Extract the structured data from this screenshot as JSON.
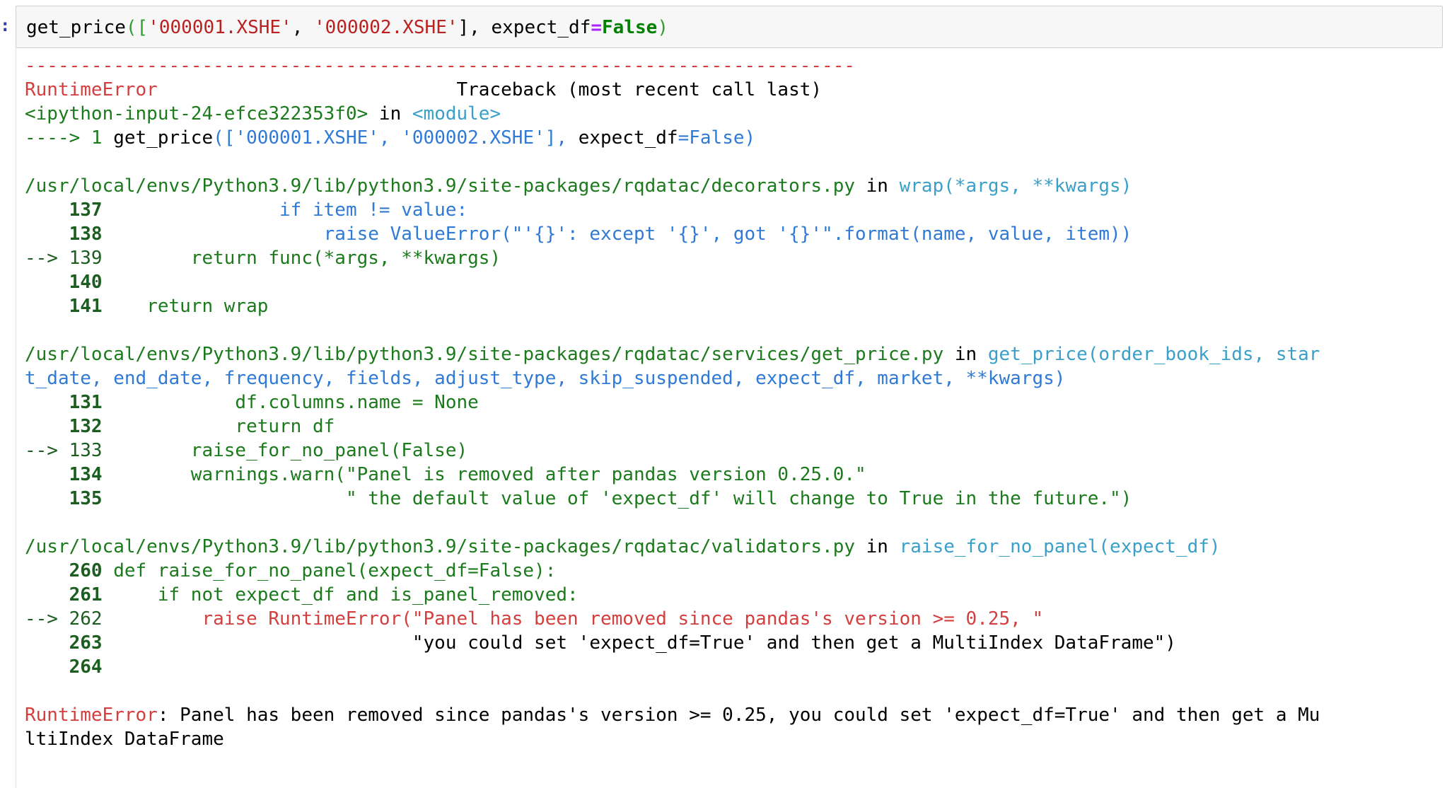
{
  "prompt": ":",
  "input": {
    "fn": "get_price",
    "open": "([",
    "arg1": "'000001.XSHE'",
    "sep1": ", ",
    "arg2": "'000002.XSHE'",
    "close_list": "], ",
    "kw": "expect_df",
    "eq": "=",
    "val": "False",
    "close": ")"
  },
  "traceback": {
    "dashes": "---------------------------------------------------------------------------",
    "error_name": "RuntimeError",
    "header_gap": "                           ",
    "header_right": "Traceback (most recent call last)",
    "input_ref": "<ipython-input-24-efce322353f0>",
    "in_word": " in ",
    "module": "<module>",
    "frame0_arrow": "----> 1 ",
    "frame0_code_a": "get_price",
    "frame0_code_b": "(['000001.XSHE', '000002.XSHE'], ",
    "frame0_code_c": "expect_df",
    "frame0_code_d": "=",
    "frame0_code_e": "False",
    "frame0_code_f": ")",
    "frames": [
      {
        "path": "/usr/local/envs/Python3.9/lib/python3.9/site-packages/rqdatac/decorators.py",
        "func": "wrap(*args, **kwargs)"
      },
      {
        "path": "/usr/local/envs/Python3.9/lib/python3.9/site-packages/rqdatac/services/get_price.py",
        "func_line1": "get_price(order_book_ids, star",
        "func_line2": "t_date, end_date, frequency, fields, adjust_type, skip_suspended, expect_df, market, **kwargs)"
      },
      {
        "path": "/usr/local/envs/Python3.9/lib/python3.9/site-packages/rqdatac/validators.py",
        "func": "raise_for_no_panel(expect_df)"
      }
    ],
    "f1": {
      "l137": "    137",
      "l137_code": "                if item != value:",
      "l138": "    138",
      "l138_code": "                    raise ValueError(\"'{}': except '{}', got '{}'\".format(name, value, item))",
      "l139_arrow": "--> 139",
      "l139_code": "        return func(*args, **kwargs)",
      "l140": "    140",
      "l141": "    141",
      "l141_code": "    return wrap"
    },
    "f2": {
      "l131": "    131",
      "l131_code": "            df.columns.name = None",
      "l132": "    132",
      "l132_code": "            return df",
      "l133_arrow": "--> 133",
      "l133_code": "        raise_for_no_panel(False)",
      "l134": "    134",
      "l134_code": "        warnings.warn(\"Panel is removed after pandas version 0.25.0.\"",
      "l135": "    135",
      "l135_code": "                      \" the default value of 'expect_df' will change to True in the future.\")"
    },
    "f3": {
      "l260": "    260",
      "l260_code": " def raise_for_no_panel(expect_df=False):",
      "l261": "    261",
      "l261_code": "     if not expect_df and is_panel_removed:",
      "l262_arrow": "--> 262",
      "l262_code": "         raise RuntimeError(\"Panel has been removed since pandas's version >= 0.25, \"",
      "l263": "    263",
      "l263_code": "                            \"you could set 'expect_df=True' and then get a MultiIndex DataFrame\")",
      "l264": "    264"
    },
    "final_error_name": "RuntimeError",
    "final_msg_line1": ": Panel has been removed since pandas's version >= 0.25, you could set 'expect_df=True' and then get a Mu",
    "final_msg_line2": "ltiIndex DataFrame"
  }
}
